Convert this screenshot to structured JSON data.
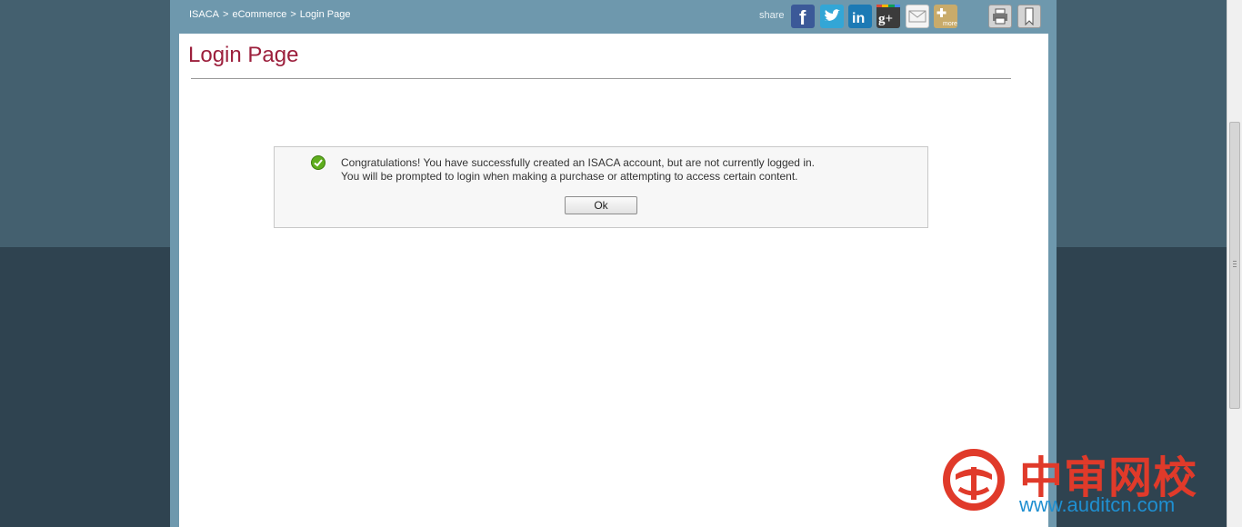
{
  "breadcrumb": {
    "items": [
      "ISACA",
      "eCommerce",
      "Login Page"
    ],
    "separator": ">"
  },
  "share": {
    "label": "share",
    "icons": [
      "facebook-icon",
      "twitter-icon",
      "linkedin-icon",
      "google-plus-icon",
      "email-icon",
      "more-icon",
      "print-icon",
      "bookmark-icon"
    ],
    "more_label": "more"
  },
  "page": {
    "title": "Login Page"
  },
  "message": {
    "line1": "Congratulations! You have successfully created an ISACA account, but are not currently logged in.",
    "line2": "You will be prompted to login when making a purchase or attempting to access certain content.",
    "ok_label": "Ok"
  },
  "watermark": {
    "chinese": "中审网校",
    "url": "www.auditcn.com"
  },
  "colors": {
    "title": "#9c1f3c",
    "header_bar": "#6e98ad",
    "background_top": "#44606f",
    "background_bottom": "#2f4350",
    "watermark_red": "#e03a2a",
    "watermark_blue": "#1f8fd0"
  }
}
